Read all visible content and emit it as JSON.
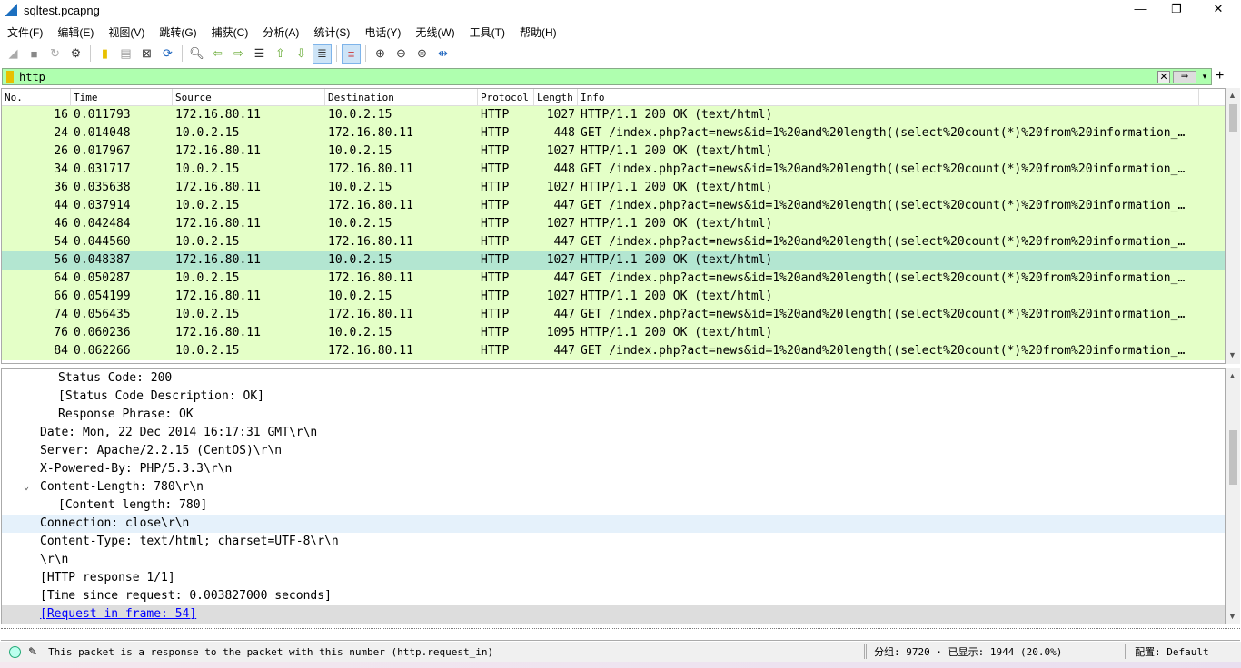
{
  "window": {
    "title": "sqltest.pcapng",
    "minimize": "—",
    "maximize": "❐",
    "close": "✕"
  },
  "menu": [
    "文件(F)",
    "编辑(E)",
    "视图(V)",
    "跳转(G)",
    "捕获(C)",
    "分析(A)",
    "统计(S)",
    "电话(Y)",
    "无线(W)",
    "工具(T)",
    "帮助(H)"
  ],
  "filter": {
    "value": "http",
    "clear": "✕",
    "apply": "⇒",
    "dropdown": "▾",
    "add": "+"
  },
  "columns": [
    "No.",
    "Time",
    "Source",
    "Destination",
    "Protocol",
    "Length",
    "Info"
  ],
  "packets": [
    [
      "16",
      "0.011793",
      "172.16.80.11",
      "10.0.2.15",
      "HTTP",
      "1027",
      "HTTP/1.1 200 OK  (text/html)"
    ],
    [
      "24",
      "0.014048",
      "10.0.2.15",
      "172.16.80.11",
      "HTTP",
      "448",
      "GET /index.php?act=news&id=1%20and%20length((select%20count(*)%20from%20information_…"
    ],
    [
      "26",
      "0.017967",
      "172.16.80.11",
      "10.0.2.15",
      "HTTP",
      "1027",
      "HTTP/1.1 200 OK  (text/html)"
    ],
    [
      "34",
      "0.031717",
      "10.0.2.15",
      "172.16.80.11",
      "HTTP",
      "448",
      "GET /index.php?act=news&id=1%20and%20length((select%20count(*)%20from%20information_…"
    ],
    [
      "36",
      "0.035638",
      "172.16.80.11",
      "10.0.2.15",
      "HTTP",
      "1027",
      "HTTP/1.1 200 OK  (text/html)"
    ],
    [
      "44",
      "0.037914",
      "10.0.2.15",
      "172.16.80.11",
      "HTTP",
      "447",
      "GET /index.php?act=news&id=1%20and%20length((select%20count(*)%20from%20information_…"
    ],
    [
      "46",
      "0.042484",
      "172.16.80.11",
      "10.0.2.15",
      "HTTP",
      "1027",
      "HTTP/1.1 200 OK  (text/html)"
    ],
    [
      "54",
      "0.044560",
      "10.0.2.15",
      "172.16.80.11",
      "HTTP",
      "447",
      "GET /index.php?act=news&id=1%20and%20length((select%20count(*)%20from%20information_…"
    ],
    [
      "56",
      "0.048387",
      "172.16.80.11",
      "10.0.2.15",
      "HTTP",
      "1027",
      "HTTP/1.1 200 OK  (text/html)"
    ],
    [
      "64",
      "0.050287",
      "10.0.2.15",
      "172.16.80.11",
      "HTTP",
      "447",
      "GET /index.php?act=news&id=1%20and%20length((select%20count(*)%20from%20information_…"
    ],
    [
      "66",
      "0.054199",
      "172.16.80.11",
      "10.0.2.15",
      "HTTP",
      "1027",
      "HTTP/1.1 200 OK  (text/html)"
    ],
    [
      "74",
      "0.056435",
      "10.0.2.15",
      "172.16.80.11",
      "HTTP",
      "447",
      "GET /index.php?act=news&id=1%20and%20length((select%20count(*)%20from%20information_…"
    ],
    [
      "76",
      "0.060236",
      "172.16.80.11",
      "10.0.2.15",
      "HTTP",
      "1095",
      "HTTP/1.1 200 OK  (text/html)"
    ],
    [
      "84",
      "0.062266",
      "10.0.2.15",
      "172.16.80.11",
      "HTTP",
      "447",
      "GET /index.php?act=news&id=1%20and%20length((select%20count(*)%20from%20information_…"
    ]
  ],
  "selected_packet": "56",
  "details": [
    {
      "text": "Status Code: 200",
      "indent": 2
    },
    {
      "text": "[Status Code Description: OK]",
      "indent": 2
    },
    {
      "text": "Response Phrase: OK",
      "indent": 2
    },
    {
      "text": "Date: Mon, 22 Dec 2014 16:17:31 GMT\\r\\n",
      "indent": 1
    },
    {
      "text": "Server: Apache/2.2.15 (CentOS)\\r\\n",
      "indent": 1
    },
    {
      "text": "X-Powered-By: PHP/5.3.3\\r\\n",
      "indent": 1
    },
    {
      "text": "Content-Length: 780\\r\\n",
      "indent": 1,
      "expanded": true
    },
    {
      "text": "[Content length: 780]",
      "indent": 2
    },
    {
      "text": "Connection: close\\r\\n",
      "indent": 1,
      "selected": true
    },
    {
      "text": "Content-Type: text/html; charset=UTF-8\\r\\n",
      "indent": 1
    },
    {
      "text": "\\r\\n",
      "indent": 1
    },
    {
      "text": "[HTTP response 1/1]",
      "indent": 1
    },
    {
      "text": "[Time since request: 0.003827000 seconds]",
      "indent": 1
    },
    {
      "text": "[Request in frame: 54]",
      "indent": 1,
      "link": true
    }
  ],
  "status": {
    "message": "This packet is a response to the packet with this number (http.request_in)",
    "packets": "分组: 9720 · 已显示: 1944 (20.0%)",
    "profile": "配置: Default"
  }
}
